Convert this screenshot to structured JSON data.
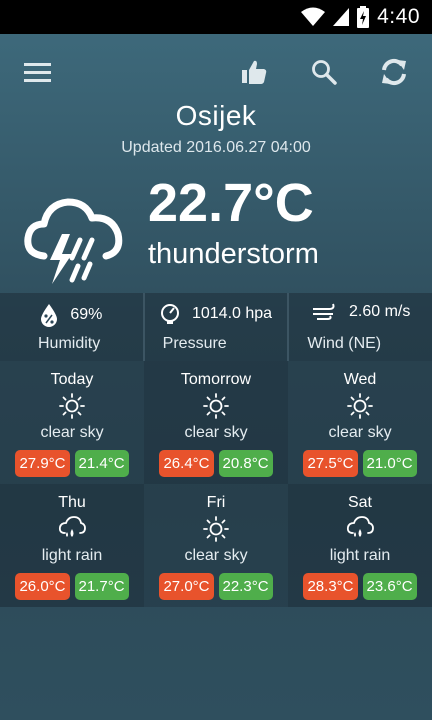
{
  "status_bar": {
    "time": "4:40"
  },
  "location": {
    "city": "Osijek",
    "updated": "Updated 2016.06.27 04:00"
  },
  "current": {
    "temperature": "22.7°C",
    "description": "thunderstorm",
    "icon": "thunderstorm-cloud-icon"
  },
  "metrics": [
    {
      "icon": "humidity-icon",
      "value": "69%",
      "label": "Humidity"
    },
    {
      "icon": "pressure-gauge-icon",
      "value": "1014.0 hpa",
      "label": "Pressure"
    },
    {
      "icon": "wind-icon",
      "value": "2.60 m/s",
      "label": "Wind (NE)"
    }
  ],
  "forecast": [
    {
      "day": "Today",
      "icon": "sun-icon",
      "description": "clear sky",
      "max": "27.9°C",
      "min": "21.4°C"
    },
    {
      "day": "Tomorrow",
      "icon": "sun-icon",
      "description": "clear sky",
      "max": "26.4°C",
      "min": "20.8°C"
    },
    {
      "day": "Wed",
      "icon": "sun-icon",
      "description": "clear sky",
      "max": "27.5°C",
      "min": "21.0°C"
    },
    {
      "day": "Thu",
      "icon": "rain-cloud-icon",
      "description": "light rain",
      "max": "26.0°C",
      "min": "21.7°C"
    },
    {
      "day": "Fri",
      "icon": "sun-icon",
      "description": "clear sky",
      "max": "27.0°C",
      "min": "22.3°C"
    },
    {
      "day": "Sat",
      "icon": "rain-cloud-icon",
      "description": "light rain",
      "max": "28.3°C",
      "min": "23.6°C"
    }
  ],
  "colors": {
    "max_temp": "#e8532c",
    "min_temp": "#4fae4b",
    "status_bar": "#000000"
  }
}
